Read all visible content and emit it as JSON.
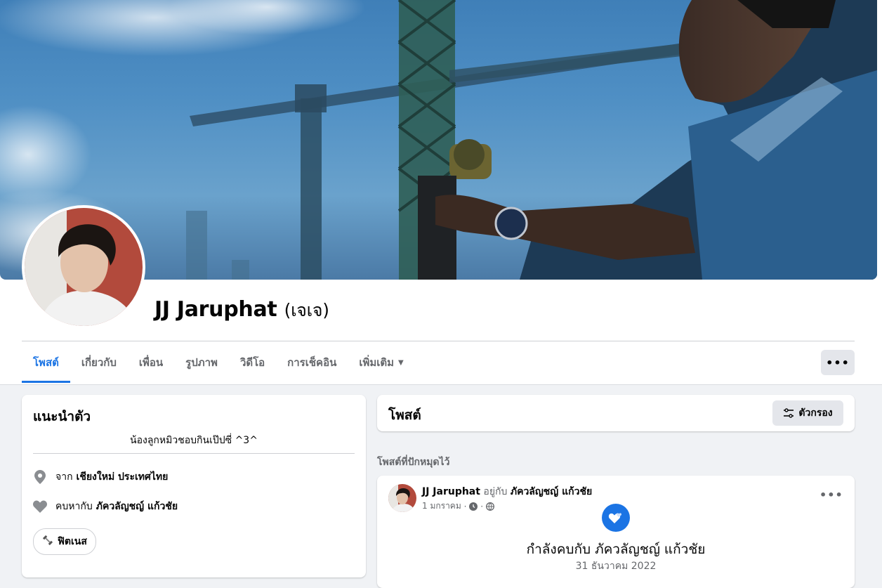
{
  "profile": {
    "name": "JJ Jaruphat",
    "alternate_name": "(เจเจ)"
  },
  "tabs": [
    {
      "label": "โพสต์",
      "active": true
    },
    {
      "label": "เกี่ยวกับ"
    },
    {
      "label": "เพื่อน"
    },
    {
      "label": "รูปภาพ"
    },
    {
      "label": "วิดีโอ"
    },
    {
      "label": "การเช็คอิน"
    },
    {
      "label": "เพิ่มเติม"
    }
  ],
  "more_button": "•••",
  "intro": {
    "title": "แนะนำตัว",
    "bio": "น้องลูกหมิวชอบกินเป๊ปซี่ ^3^",
    "from_prefix": "จาก",
    "from_place": "เชียงใหม่ ประเทศไทย",
    "relationship_prefix": "คบหากับ",
    "relationship_partner": "ภัควลัญชญ์ แก้วชัย",
    "hobby": "ฟิตเนส"
  },
  "posts": {
    "title": "โพสต์",
    "filter_label": "ตัวกรอง",
    "pinned_label": "โพสต์ที่ปักหมุดไว้",
    "pinned_post": {
      "author": "JJ Jaruphat",
      "with_text": "อยู่กับ",
      "with_person": "ภัควลัญชญ์ แก้วชัย",
      "date": "1 มกราคม",
      "more": "•••",
      "event_title": "กำลังคบกับ ภัควลัญชญ์ แก้วชัย",
      "event_date": "31 ธันวาคม 2022"
    }
  },
  "colors": {
    "accent": "#1b74e4",
    "page_bg": "#f0f2f5",
    "muted_text": "#65676b"
  },
  "icons": {
    "location": "map-pin-icon",
    "relationship": "heart-icon",
    "hobby": "dumbbell-icon",
    "filter": "sliders-icon",
    "privacy": "globe-icon",
    "clock": "clock-icon"
  }
}
